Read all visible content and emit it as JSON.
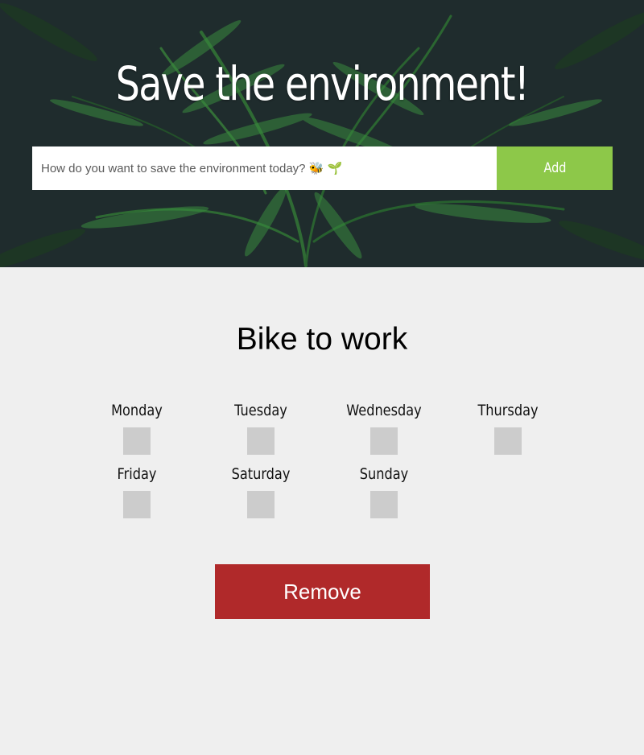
{
  "header": {
    "title": "Save the environment!",
    "input_placeholder": "How do you want to save the environment today? 🐝 🌱",
    "add_label": "Add"
  },
  "task": {
    "title": "Bike to work",
    "days": [
      {
        "label": "Monday",
        "checked": false
      },
      {
        "label": "Tuesday",
        "checked": false
      },
      {
        "label": "Wednesday",
        "checked": false
      },
      {
        "label": "Thursday",
        "checked": false
      },
      {
        "label": "Friday",
        "checked": false
      },
      {
        "label": "Saturday",
        "checked": false
      },
      {
        "label": "Sunday",
        "checked": false
      }
    ],
    "remove_label": "Remove"
  },
  "colors": {
    "hero_background": "#1f2c2d",
    "add_button": "#8dc849",
    "remove_button": "#b0292a",
    "page_background": "#efefef",
    "day_box": "#cccccc"
  }
}
